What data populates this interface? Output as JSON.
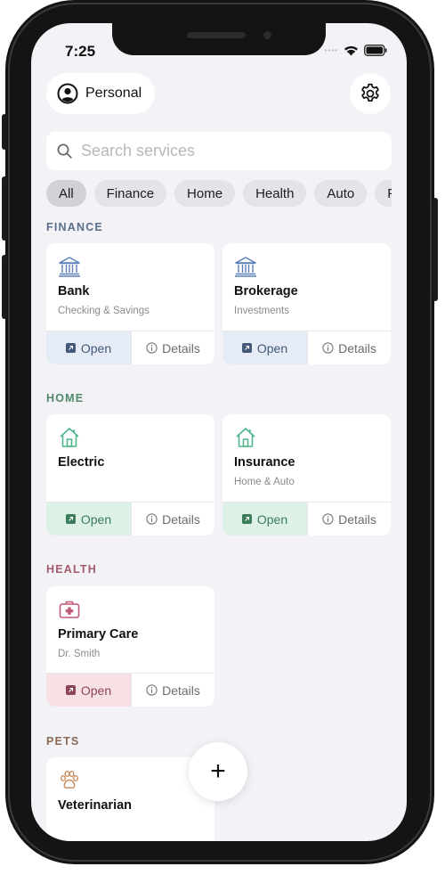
{
  "status_bar": {
    "time": "7:25"
  },
  "header": {
    "profile_label": "Personal"
  },
  "search": {
    "placeholder": "Search services",
    "value": ""
  },
  "filters": [
    "All",
    "Finance",
    "Home",
    "Health",
    "Auto",
    "Pets"
  ],
  "colors": {
    "finance": "#5a6e8c",
    "finance_open_bg": "#e5ecf5",
    "finance_open_fg": "#44597a",
    "home": "#4e8a6a",
    "home_open_bg": "#ddf1e6",
    "home_open_fg": "#3b7d5a",
    "health": "#a55a6c",
    "health_open_bg": "#f7e1e5",
    "health_open_fg": "#8c4556",
    "pets": "#8c6a55"
  },
  "sections": [
    {
      "title": "FINANCE",
      "cards": [
        {
          "icon": "bank-icon",
          "title": "Bank",
          "subtitle": "Checking & Savings",
          "open": "Open",
          "details": "Details"
        },
        {
          "icon": "bank-icon",
          "title": "Brokerage",
          "subtitle": "Investments",
          "open": "Open",
          "details": "Details"
        }
      ]
    },
    {
      "title": "HOME",
      "cards": [
        {
          "icon": "house-icon",
          "title": "Electric",
          "subtitle": "",
          "open": "Open",
          "details": "Details"
        },
        {
          "icon": "house-icon",
          "title": "Insurance",
          "subtitle": "Home & Auto",
          "open": "Open",
          "details": "Details"
        }
      ]
    },
    {
      "title": "HEALTH",
      "cards": [
        {
          "icon": "medical-kit-icon",
          "title": "Primary Care",
          "subtitle": "Dr. Smith",
          "open": "Open",
          "details": "Details"
        }
      ]
    },
    {
      "title": "PETS",
      "cards": [
        {
          "icon": "paw-icon",
          "title": "Veterinarian",
          "subtitle": ""
        }
      ]
    }
  ],
  "fab": {
    "label": "+"
  }
}
